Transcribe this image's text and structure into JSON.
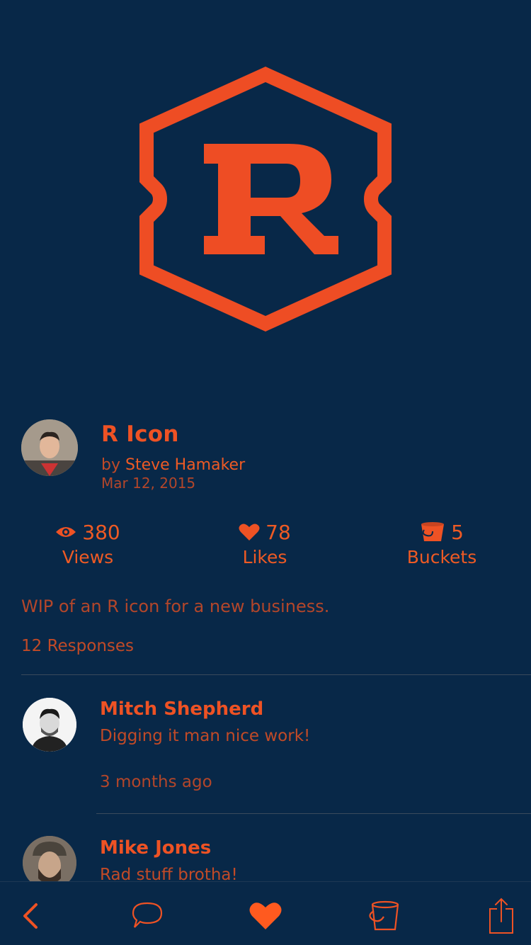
{
  "shot": {
    "title": "R Icon",
    "by_prefix": "by",
    "author": "Steve Hamaker",
    "date": "Mar 12, 2015",
    "description": "WIP of an R icon for a new business.",
    "logo_letter": "R"
  },
  "stats": {
    "views": {
      "value": "380",
      "label": "Views",
      "icon": "eye-icon"
    },
    "likes": {
      "value": "78",
      "label": "Likes",
      "icon": "heart-icon"
    },
    "buckets": {
      "value": "5",
      "label": "Buckets",
      "icon": "bucket-icon"
    }
  },
  "responses": {
    "count_label": "12 Responses",
    "items": [
      {
        "name": "Mitch Shepherd",
        "text": "Digging it man nice work!",
        "time": "3 months ago"
      },
      {
        "name": "Mike Jones",
        "text": "Rad stuff brotha!"
      }
    ]
  },
  "tabbar": {
    "items": [
      "back-icon",
      "comment-icon",
      "like-icon",
      "bucket-icon",
      "share-icon"
    ]
  },
  "colors": {
    "background": "#082848",
    "accent": "#ee5224",
    "muted": "#b3462a"
  }
}
